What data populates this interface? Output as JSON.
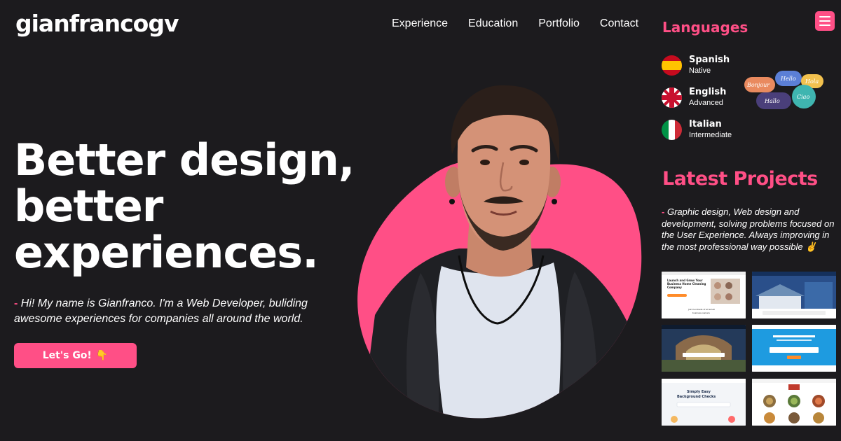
{
  "header": {
    "logo": "gianfrancogv",
    "nav": [
      "Experience",
      "Education",
      "Portfolio",
      "Contact"
    ]
  },
  "hero": {
    "title_lines": [
      "Better design,",
      "better",
      "experiences."
    ],
    "intro_dash": "-",
    "intro": "Hi! My name is Gianfranco. I'm a Web Developer, buliding awesome experiences for companies all around the world.",
    "cta_label": "Let's Go!",
    "cta_emoji": "👇"
  },
  "languages": {
    "title": "Languages",
    "items": [
      {
        "name": "Spanish",
        "level": "Native",
        "flag": "spain-flag-icon"
      },
      {
        "name": "English",
        "level": "Advanced",
        "flag": "uk-flag-icon"
      },
      {
        "name": "Italian",
        "level": "Intermediate",
        "flag": "italy-flag-icon"
      }
    ],
    "bubbles": [
      "Bonjour",
      "Hello",
      "Hola",
      "Hallo",
      "Ciao"
    ]
  },
  "projects": {
    "title": "Latest Projects",
    "dash": "-",
    "description": "Graphic design, Web design and development, solving problems focused on the User Experience. Always improving in the most professional way possible",
    "emoji": "✌",
    "thumbnails": [
      {
        "headline": "Launch and Grow Your Business Home Cleaning Company",
        "footer": "Join hundreds of all small business owners"
      },
      {
        "headline": "Software to Grow Your Roofing Business",
        "footer": ""
      },
      {
        "headline": "",
        "footer": ""
      },
      {
        "headline": "Made for Booking & Marketing Software for your Maid Service",
        "footer": ""
      },
      {
        "headline": "Simply Easy Background Checks",
        "footer": ""
      },
      {
        "headline": "",
        "footer": ""
      }
    ]
  },
  "colors": {
    "accent": "#ff4f86",
    "background": "#1c1b1e",
    "text": "#ffffff"
  }
}
